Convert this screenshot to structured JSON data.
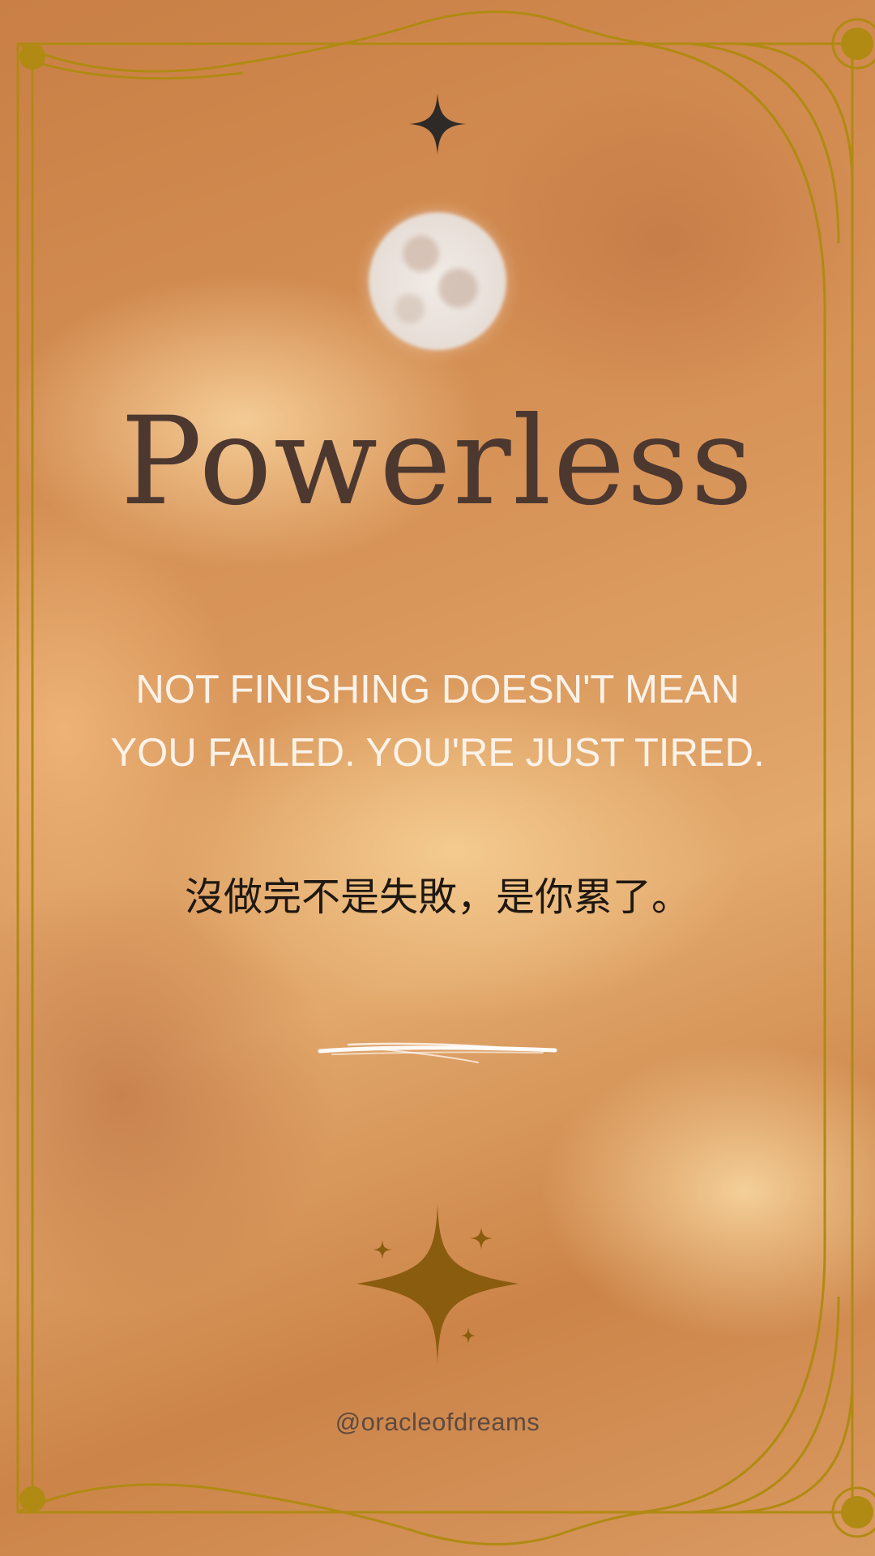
{
  "card": {
    "title": "Powerless",
    "quote_en_line1": "NOT FINISHING DOESN'T MEAN",
    "quote_en_line2": "YOU FAILED. YOU'RE JUST TIRED.",
    "quote_zh": "沒做完不是失敗，是你累了。",
    "handle": "@oracleofdreams"
  },
  "colors": {
    "background": "#cf8a4e",
    "frame_gold": "#b08a12",
    "title": "#4d3830",
    "quote_en": "#fbf3ea",
    "quote_zh": "#1f1812",
    "handle": "#5e4a40",
    "top_star": "#2e2a28",
    "sparkle": "#8a5c10"
  },
  "icons": {
    "top": "four-point-star-icon",
    "center": "full-moon",
    "divider": "brush-stroke",
    "bottom": "sparkle-cluster-icon"
  }
}
